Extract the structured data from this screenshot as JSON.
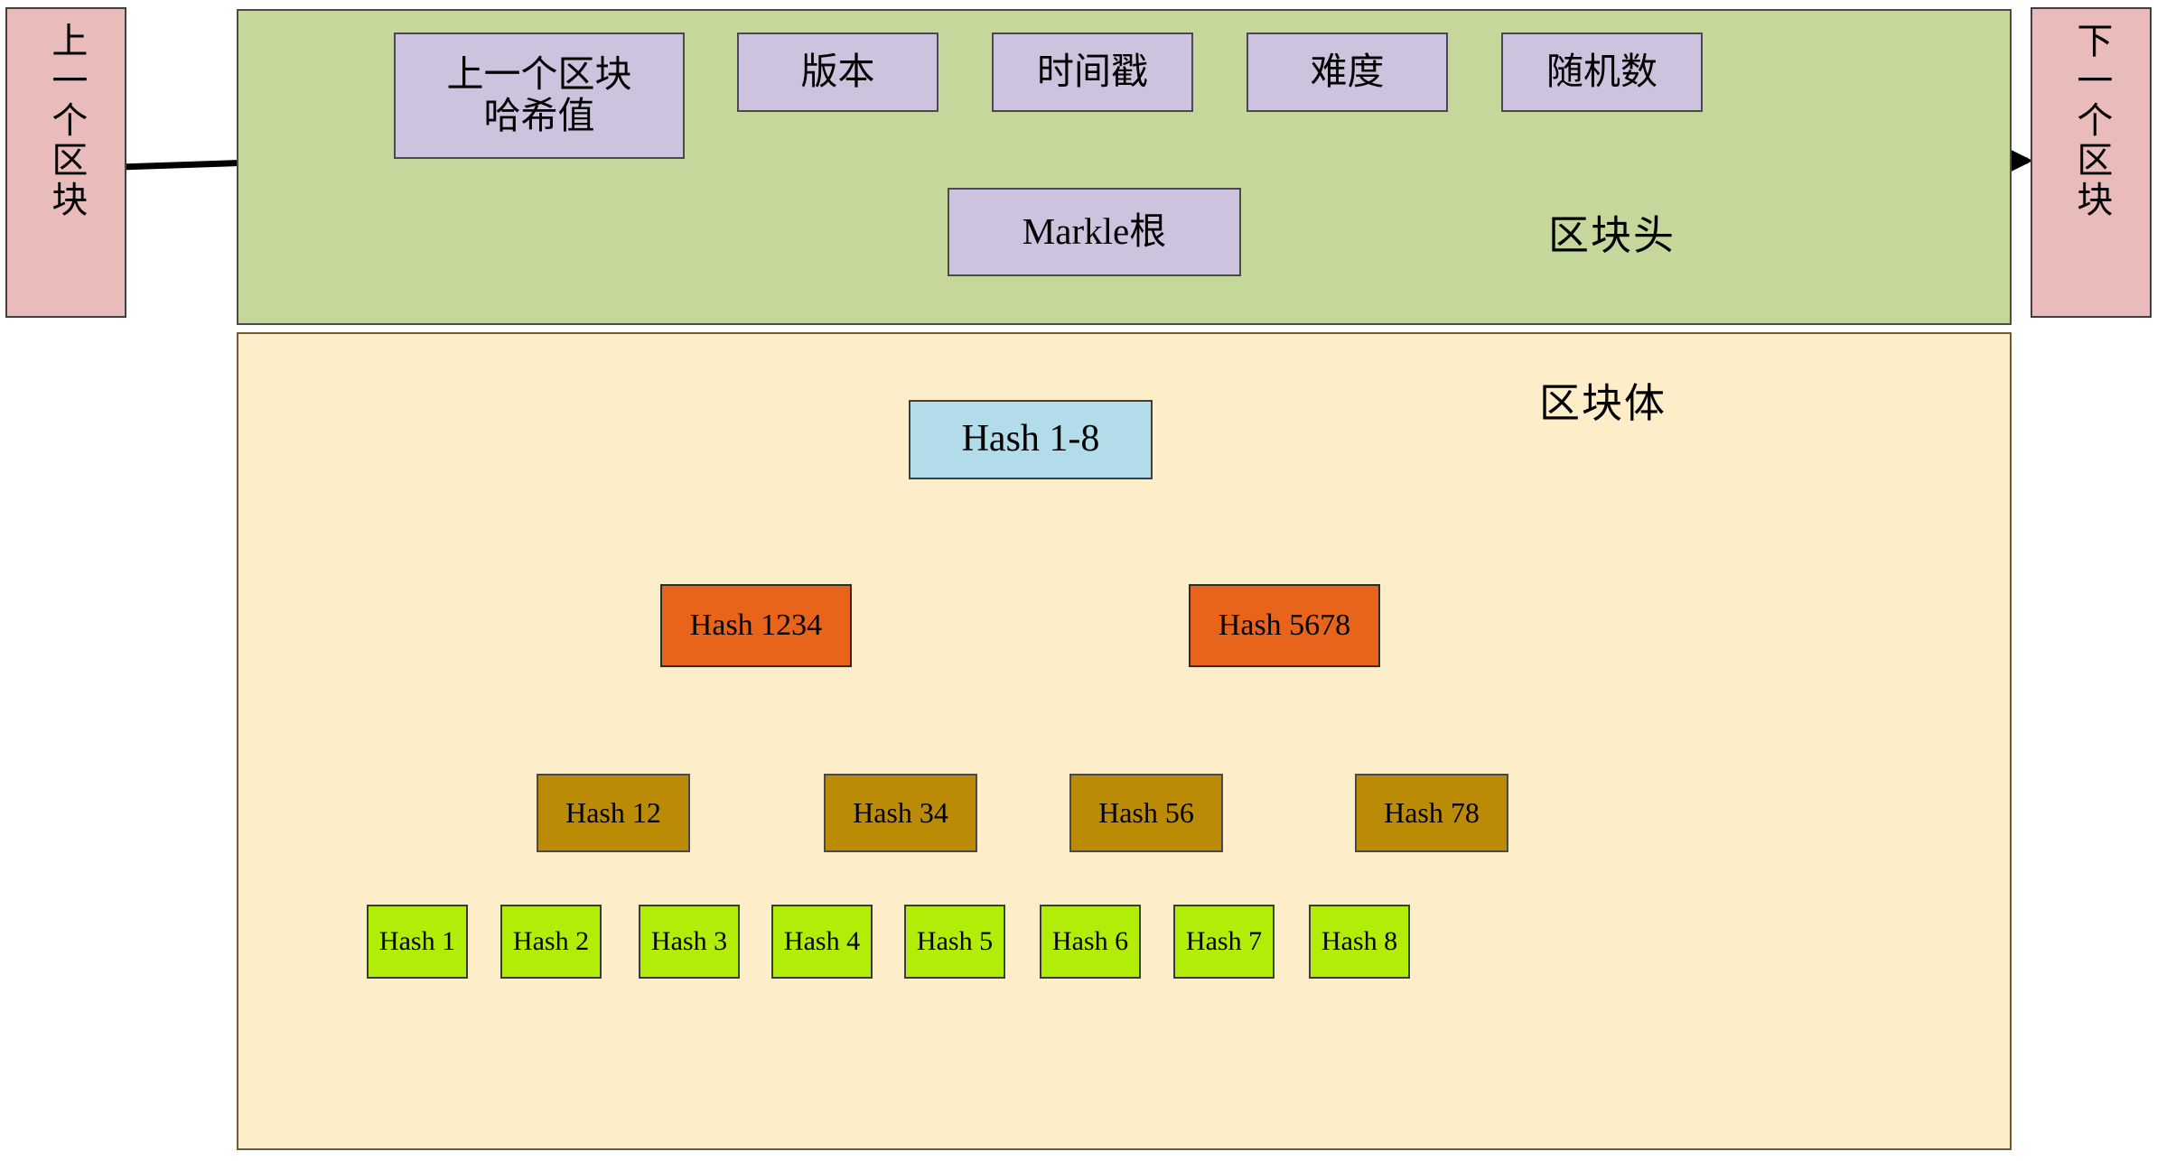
{
  "diagram": {
    "title": "Blockchain block structure with Merkle tree",
    "colors": {
      "prev_next_block": "#eabbbb",
      "block_header": "#c5d79a",
      "header_field": "#cdc3de",
      "block_body": "#fdeec9",
      "merkle_root": "#b3dcea",
      "merkle_level1": "#e8641a",
      "merkle_level2": "#bc8b06",
      "merkle_leaf": "#b2ed08"
    }
  },
  "prev_block": {
    "label": "上一个区块"
  },
  "next_block": {
    "label": "下一个区块"
  },
  "block_header": {
    "section_label": "区块头",
    "fields": [
      {
        "id": "prev-hash",
        "label": "上一个区块\n哈希值"
      },
      {
        "id": "version",
        "label": "版本"
      },
      {
        "id": "timestamp",
        "label": "时间戳"
      },
      {
        "id": "difficulty",
        "label": "难度"
      },
      {
        "id": "nonce",
        "label": "随机数"
      },
      {
        "id": "merkle-root",
        "label": "Markle根"
      }
    ]
  },
  "block_body": {
    "section_label": "区块体",
    "merkle_tree": {
      "root": {
        "id": "hash-1-8",
        "label": "Hash 1-8"
      },
      "level1": [
        {
          "id": "hash-1234",
          "label": "Hash 1234"
        },
        {
          "id": "hash-5678",
          "label": "Hash 5678"
        }
      ],
      "level2": [
        {
          "id": "hash-12",
          "label": "Hash 12"
        },
        {
          "id": "hash-34",
          "label": "Hash 34"
        },
        {
          "id": "hash-56",
          "label": "Hash 56"
        },
        {
          "id": "hash-78",
          "label": "Hash 78"
        }
      ],
      "leaves": [
        {
          "id": "hash-1",
          "label": "Hash 1"
        },
        {
          "id": "hash-2",
          "label": "Hash 2"
        },
        {
          "id": "hash-3",
          "label": "Hash 3"
        },
        {
          "id": "hash-4",
          "label": "Hash 4"
        },
        {
          "id": "hash-5",
          "label": "Hash 5"
        },
        {
          "id": "hash-6",
          "label": "Hash 6"
        },
        {
          "id": "hash-7",
          "label": "Hash 7"
        },
        {
          "id": "hash-8",
          "label": "Hash 8"
        }
      ]
    }
  }
}
